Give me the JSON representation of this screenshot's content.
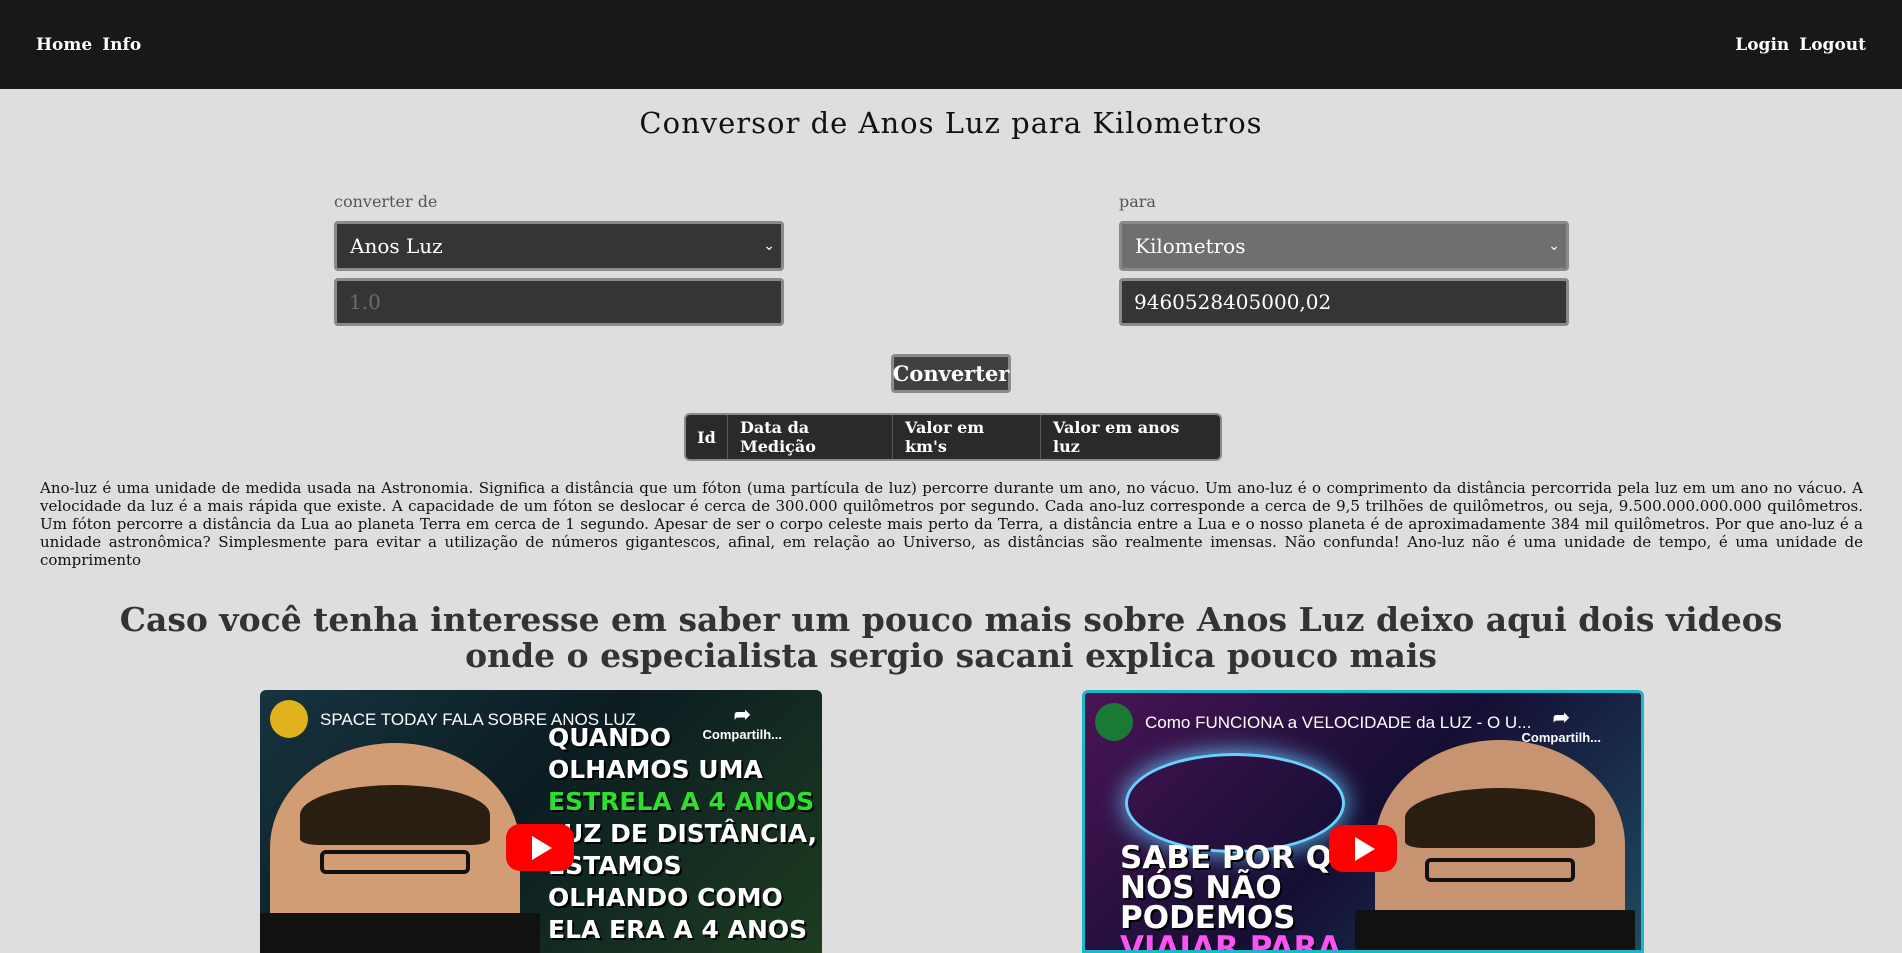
{
  "nav": {
    "left": [
      "Home",
      "Info"
    ],
    "right": [
      "Login",
      "Logout"
    ]
  },
  "page": {
    "title": "Conversor de Anos Luz para Kilometros"
  },
  "converter": {
    "from_label": "converter de",
    "from_selected": "Anos Luz",
    "to_label": "para",
    "to_selected": "Kilometros",
    "input_placeholder": "1.0",
    "output_value": "9460528405000,02",
    "button_label": "Converter"
  },
  "table": {
    "columns": [
      "Id",
      "Data da Medição",
      "Valor em km's",
      "Valor em anos luz"
    ]
  },
  "description": "Ano-luz é uma unidade de medida usada na Astronomia. Significa a distância que um fóton (uma partícula de luz) percorre durante um ano, no vácuo. Um ano-luz é o comprimento da distância percorrida pela luz em um ano no vácuo. A velocidade da luz é a mais rápida que existe. A capacidade de um fóton se deslocar é cerca de 300.000 quilômetros por segundo. Cada ano-luz corresponde a cerca de 9,5 trilhões de quilômetros, ou seja, 9.500.000.000.000 quilômetros. Um fóton percorre a distância da Lua ao planeta Terra em cerca de 1 segundo. Apesar de ser o corpo celeste mais perto da Terra, a distância entre a Lua e o nosso planeta é de aproximadamente 384 mil quilômetros. Por que ano-luz é a unidade astronômica? Simplesmente para evitar a utilização de números gigantescos, afinal, em relação ao Universo, as distâncias são realmente imensas. Não confunda! Ano-luz não é uma unidade de tempo, é uma unidade de comprimento",
  "videos_heading": "Caso você tenha interesse em saber um pouco mais sobre Anos Luz deixo aqui dois videos onde o especialista sergio sacani explica pouco mais",
  "videos": [
    {
      "title": "SPACE TODAY FALA SOBRE ANOS LUZ",
      "share_label": "Compartilh...",
      "thumb_lines": [
        "QUANDO",
        "OLHAMOS UMA",
        "ESTRELA A 4 ANOS",
        "LUZ DE DISTÂNCIA,",
        "ESTAMOS",
        "OLHANDO COMO",
        "ELA ERA A 4 ANOS"
      ]
    },
    {
      "title": "Como FUNCIONA a VELOCIDADE da LUZ - O U...",
      "share_label": "Compartilh...",
      "thumb_lines": [
        "SABE POR Q",
        "NÓS NÃO",
        "PODEMOS",
        "VIAJAR PARA"
      ]
    }
  ],
  "colors": {
    "navbar": "#181818",
    "background": "#dedede",
    "play": "#ff0000"
  }
}
